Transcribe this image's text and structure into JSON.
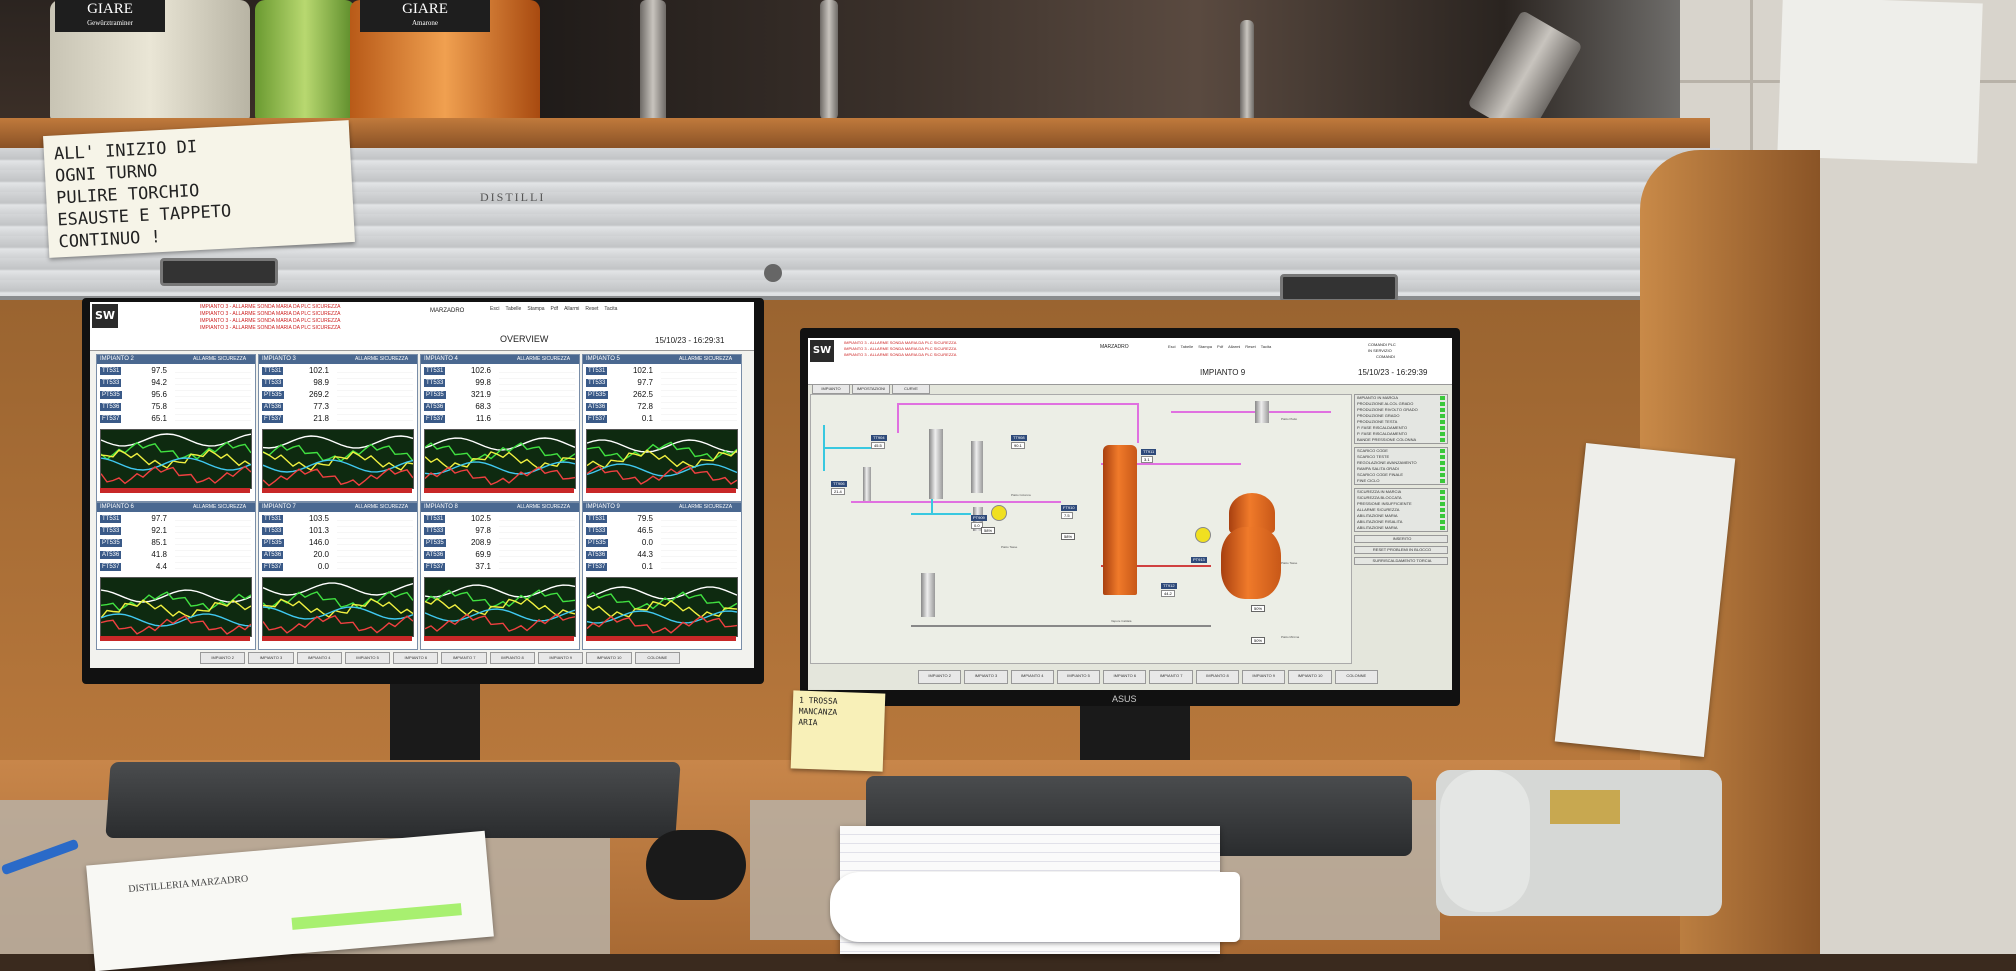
{
  "background_text": {
    "bottle_label_1": "GIARE",
    "bottle_label_1_sub": "Gewürztraminer",
    "bottle_label_2": "GIARE",
    "bottle_label_2_sub": "Amarone",
    "shutter_brand": "DISTILLI",
    "note_paper": [
      "ALL' INIZIO DI",
      "OGNI TURNO",
      "PULIRE TORCHIO",
      "ESAUSTE E TAPPETO",
      "CONTINUO !"
    ],
    "sticky_note": [
      "1 TROSSA",
      "MANCANZA",
      "ARIA"
    ],
    "notebook_label": "DISTILLERIA MARZADRO",
    "monitor_brand": "ASUS"
  },
  "left_monitor": {
    "logo": "SW",
    "user": "MARZADRO",
    "title": "OVERVIEW",
    "datetime": "15/10/23 - 16:29:31",
    "toolbar_labels": [
      "Esci",
      "Tabelle",
      "Stampa",
      "Pdf",
      "Allarmi",
      "Reset",
      "Tacita"
    ],
    "alarm_lines": [
      "IMPIANTO 3 - ALLARME SONDA MARIA DA PLC SICUREZZA",
      "IMPIANTO 3 - ALLARME SONDA MARIA DA PLC SICUREZZA",
      "IMPIANTO 3 - ALLARME SONDA MARIA DA PLC SICUREZZA",
      "IMPIANTO 3 - ALLARME SONDA MARIA DA PLC SICUREZZA"
    ],
    "panels": [
      {
        "title": "IMPIANTO 2",
        "tags": [
          "TT531",
          "TT533",
          "PT535",
          "TT536",
          "FT537"
        ],
        "values": [
          "97.5",
          "94.2",
          "95.6",
          "75.8",
          "65.1"
        ]
      },
      {
        "title": "IMPIANTO 3",
        "tags": [
          "TT531",
          "TT533",
          "PT535",
          "AT536",
          "FT537"
        ],
        "values": [
          "102.1",
          "98.9",
          "269.2",
          "77.3",
          "21.8"
        ]
      },
      {
        "title": "IMPIANTO 4",
        "tags": [
          "TT531",
          "TT533",
          "PT535",
          "AT536",
          "FT537"
        ],
        "values": [
          "102.6",
          "99.8",
          "321.9",
          "68.3",
          "11.6"
        ]
      },
      {
        "title": "IMPIANTO 5",
        "tags": [
          "TT531",
          "TT533",
          "PT535",
          "AT536",
          "FT537"
        ],
        "values": [
          "102.1",
          "97.7",
          "262.5",
          "72.8",
          "0.1"
        ]
      },
      {
        "title": "IMPIANTO 6",
        "tags": [
          "TT531",
          "TT533",
          "PT535",
          "AT536",
          "FT537"
        ],
        "values": [
          "97.7",
          "92.1",
          "85.1",
          "41.8",
          "4.4"
        ]
      },
      {
        "title": "IMPIANTO 7",
        "tags": [
          "TT531",
          "TT533",
          "PT535",
          "AT536",
          "FT537"
        ],
        "values": [
          "103.5",
          "101.3",
          "146.0",
          "20.0",
          "0.0"
        ]
      },
      {
        "title": "IMPIANTO 8",
        "tags": [
          "TT531",
          "TT533",
          "PT535",
          "AT536",
          "FT537"
        ],
        "values": [
          "102.5",
          "97.8",
          "208.9",
          "69.9",
          "37.1"
        ]
      },
      {
        "title": "IMPIANTO 9",
        "tags": [
          "TT531",
          "TT533",
          "PT535",
          "AT536",
          "FT537"
        ],
        "values": [
          "79.5",
          "46.5",
          "0.0",
          "44.3",
          "0.1"
        ]
      }
    ],
    "panel_status": "ALLARME SICUREZZA",
    "nav_buttons": [
      "IMPIANTO 2",
      "IMPIANTO 3",
      "IMPIANTO 4",
      "IMPIANTO 5",
      "IMPIANTO 6",
      "IMPIANTO 7",
      "IMPIANTO 8",
      "IMPIANTO 9",
      "IMPIANTO 10",
      "COLONNE"
    ]
  },
  "right_monitor": {
    "logo": "SW",
    "user": "MARZADRO",
    "title": "IMPIANTO 9",
    "datetime": "15/10/23 - 16:29:39",
    "toolbar_labels": [
      "Esci",
      "Tabelle",
      "Stampa",
      "Pdf",
      "Allarmi",
      "Reset",
      "Tacita"
    ],
    "status_labels": [
      "COMANDI PLC",
      "IN SERVIZIO",
      "COMANDI"
    ],
    "tabs": [
      "IMPIANTO",
      "IMPOSTAZIONI",
      "CURVE"
    ],
    "alarm_lines": [
      "IMPIANTO 3 - ALLARME SONDA MARIA DA PLC SICUREZZA",
      "IMPIANTO 3 - ALLARME SONDA MARIA DA PLC SICUREZZA",
      "IMPIANTO 3 - ALLARME SONDA MARIA DA PLC SICUREZZA"
    ],
    "process_tags": [
      "TT904",
      "TT906",
      "TT908",
      "PT909",
      "TT911",
      "FT910",
      "TT912",
      "PT913"
    ],
    "process_values": [
      "45.5",
      "21.4",
      "90.1",
      "0.0",
      "3.1",
      "7.5",
      "44.2"
    ],
    "percent_values": [
      "58%",
      "58%",
      "50%",
      "50%"
    ],
    "pipe_labels": [
      "Piatto Piatto",
      "Piatto Colonna",
      "Piatto Tasse",
      "Piatto Tasse",
      "Piatto Minima",
      "Vapore Caldaia"
    ],
    "side_buttons_top": [
      "IMPIANTO IN MARCIA",
      "PRODUZIONE ALCOL GRADO",
      "PRODUZIONE RIVOLTO GRADO",
      "PRODUZIONE GRADO",
      "PRODUZIONE TESTA",
      "P. FASE RISCALDAMENTO",
      "P. FASE RISCALDAMENTO",
      "BANDE PRESSIONE COLONNA"
    ],
    "side_buttons_mid": [
      "SCARICO CODE",
      "SCARICO TESTE",
      "REGOLAZIONE AVANZAMENTO",
      "RAMPA SALITA GRADI",
      "SCARICO CODE FINALE",
      "FINE CICLO"
    ],
    "side_buttons_low": [
      "SICUREZZA IN MARCIA",
      "SICUREZZA BLOCCATA",
      "PRESSIONE INSUFFICIENTE",
      "ALLARME SICUREZZA",
      "ABILITAZIONE MARIA",
      "ABILITAZIONE RISALITA",
      "ABILITAZIONE MARIA"
    ],
    "side_action_1": "INSERITO",
    "side_action_2": "RESET PROBLEMI IN BLOCCO",
    "side_action_3": "SURRISCALDAMENTO TORCIA",
    "nav_buttons": [
      "IMPIANTO 2",
      "IMPIANTO 3",
      "IMPIANTO 4",
      "IMPIANTO 5",
      "IMPIANTO 6",
      "IMPIANTO 7",
      "IMPIANTO 8",
      "IMPIANTO 9",
      "IMPIANTO 10",
      "COLONNE"
    ]
  },
  "colors": {
    "vessel_orange": "#f07a2a",
    "pipe_magenta": "#e070e0",
    "pipe_cyan": "#38c8e0",
    "panel_blue": "#4a6890",
    "trend_bg": "#0e2a10"
  }
}
